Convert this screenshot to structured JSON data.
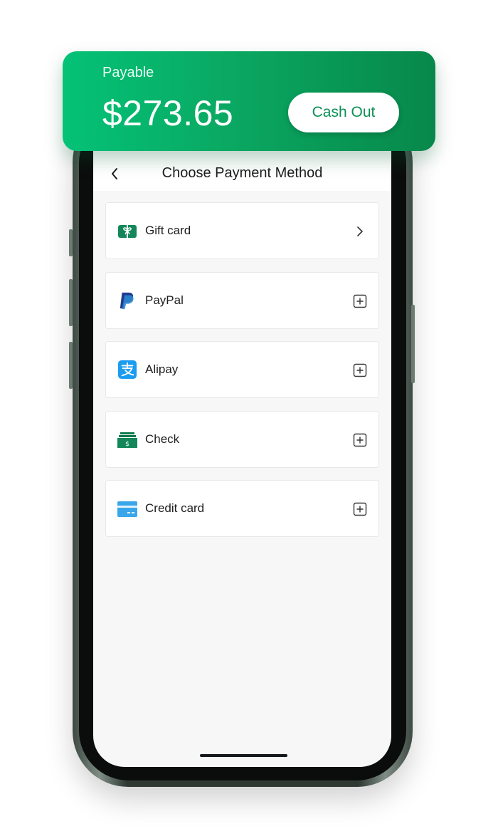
{
  "banner": {
    "label": "Payable",
    "amount": "$273.65",
    "cash_out_label": "Cash Out"
  },
  "screen": {
    "title": "Choose Payment Method",
    "back_icon": "chevron-left-icon"
  },
  "methods": [
    {
      "label": "Gift card",
      "icon": "gift-card-icon",
      "action": "chevron-right-icon"
    },
    {
      "label": "PayPal",
      "icon": "paypal-icon",
      "action": "plus-square-icon"
    },
    {
      "label": "Alipay",
      "icon": "alipay-icon",
      "action": "plus-square-icon"
    },
    {
      "label": "Check",
      "icon": "check-icon",
      "action": "plus-square-icon"
    },
    {
      "label": "Credit card",
      "icon": "credit-card-icon",
      "action": "plus-square-icon"
    }
  ],
  "colors": {
    "brand_green": "#0aa862",
    "paypal_blue": "#1f3b8f",
    "alipay_blue": "#1a9cf0",
    "credit_card_blue": "#3aa6ea"
  }
}
